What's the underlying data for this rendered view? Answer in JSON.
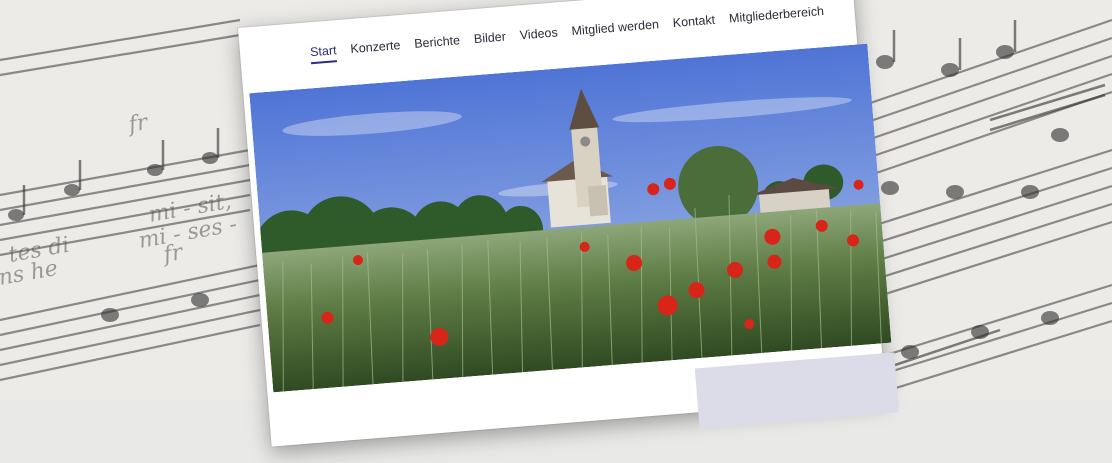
{
  "nav": {
    "items": [
      {
        "label": "Start",
        "active": true
      },
      {
        "label": "Konzerte",
        "active": false
      },
      {
        "label": "Berichte",
        "active": false
      },
      {
        "label": "Bilder",
        "active": false
      },
      {
        "label": "Videos",
        "active": false
      },
      {
        "label": "Mitglied werden",
        "active": false
      },
      {
        "label": "Kontakt",
        "active": false
      },
      {
        "label": "Mitgliederbereich",
        "active": false
      }
    ]
  },
  "background": {
    "lyrics": [
      "fr",
      "mi - sit,",
      "tes di",
      "mi - ses -",
      "ns he",
      "fr"
    ]
  },
  "colors": {
    "accent": "#2e2a86",
    "sky": "#6f8fd8",
    "poppy": "#d9241a"
  }
}
